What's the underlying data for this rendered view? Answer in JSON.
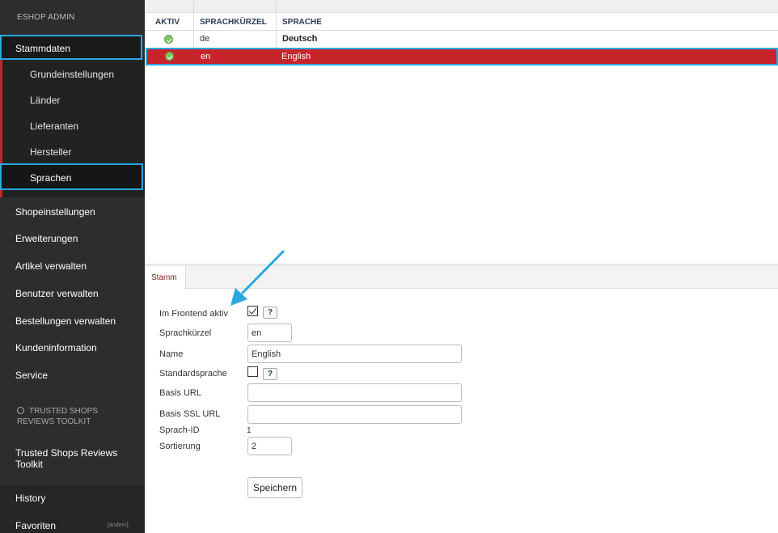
{
  "sidebar": {
    "brand": "ESHOP ADMIN",
    "active_section": "Stammdaten",
    "sub_items": [
      "Grundeinstellungen",
      "Länder",
      "Lieferanten",
      "Hersteller",
      "Sprachen"
    ],
    "items": [
      "Shopeinstellungen",
      "Erweiterungen",
      "Artikel verwalten",
      "Benutzer verwalten",
      "Bestellungen verwalten",
      "Kundeninformation",
      "Service"
    ],
    "ts_section_line1": "TRUSTED SHOPS",
    "ts_section_line2": "REVIEWS TOOLKIT",
    "ts_link": "Trusted Shops Reviews Toolkit",
    "history": "History",
    "favorites": "Favoriten",
    "favorites_edit": "[ändern]"
  },
  "table": {
    "columns": [
      "AKTIV",
      "SPRACHKÜRZEL",
      "SPRACHE"
    ],
    "rows": [
      {
        "active": true,
        "code": "de",
        "language": "Deutsch",
        "selected": false
      },
      {
        "active": true,
        "code": "en",
        "language": "English",
        "selected": true
      }
    ]
  },
  "edit": {
    "tab": "Stamm",
    "labels": {
      "frontend_active": "Im Frontend aktiv",
      "code": "Sprachkürzel",
      "name": "Name",
      "default_lang": "Standardsprache",
      "base_url": "Basis URL",
      "base_ssl_url": "Basis SSL URL",
      "lang_id": "Sprach-ID",
      "sort": "Sortierung"
    },
    "values": {
      "frontend_active": true,
      "code": "en",
      "name": "English",
      "default_lang": false,
      "base_url": "",
      "base_ssl_url": "",
      "lang_id": "1",
      "sort": "2"
    },
    "help_glyph": "?",
    "save_label": "Speichern"
  },
  "colors": {
    "sidebar_bg": "#2d2d2d",
    "highlight_border": "#29a8e0",
    "selected_row": "#c8242b",
    "status_active": "#7cc35b"
  }
}
